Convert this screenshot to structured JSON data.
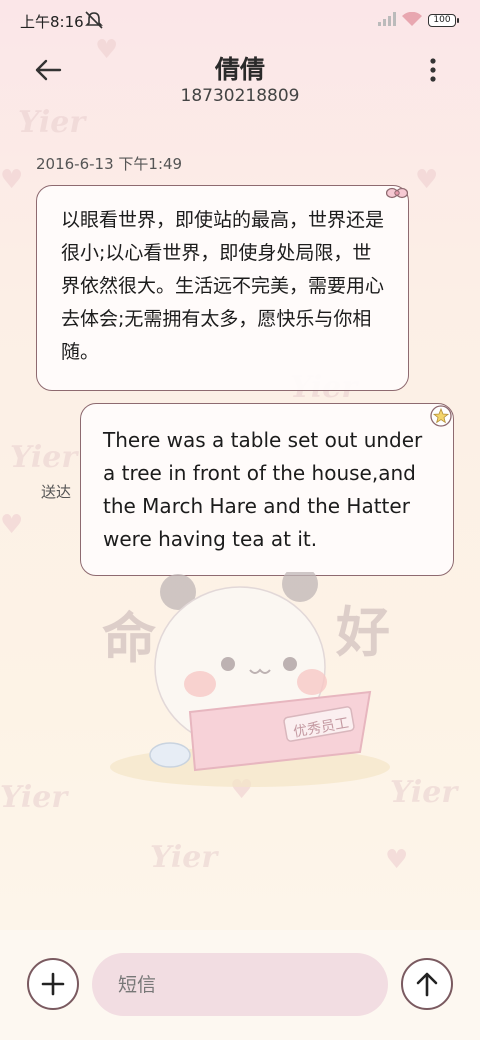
{
  "status_bar": {
    "time": "上午8:16",
    "battery": "100",
    "icons": [
      "mute-icon",
      "signal-icon",
      "wifi-icon",
      "battery-icon"
    ]
  },
  "header": {
    "contact_name": "倩倩",
    "contact_number": "18730218809",
    "back_icon": "arrow-left-icon",
    "more_icon": "more-vertical-icon"
  },
  "conversation": {
    "timestamp": "2016-6-13 下午1:49",
    "incoming_message": "以眼看世界，即使站的最高，世界还是很小;以心看世界，即使身处局限，世界依然很大。生活远不完美，需要用心去体会;无需拥有太多，愿快乐与你相随。",
    "outgoing_message": "There was a table set out under a tree in front of the house,and the March Hare and the Hatter were having tea at it.",
    "delivery_status": "送达"
  },
  "background": {
    "watermark_text": "Yier",
    "sticker_text_left": "命",
    "sticker_text_right": "好",
    "sticker_badge": "优秀员工"
  },
  "composer": {
    "placeholder": "短信",
    "add_icon": "plus-icon",
    "send_icon": "arrow-up-icon"
  },
  "colors": {
    "bubble_border": "#8e6a70",
    "input_bg": "#f2dde2",
    "background_top": "#fbe6e8",
    "background_bottom": "#fdf6ec"
  }
}
